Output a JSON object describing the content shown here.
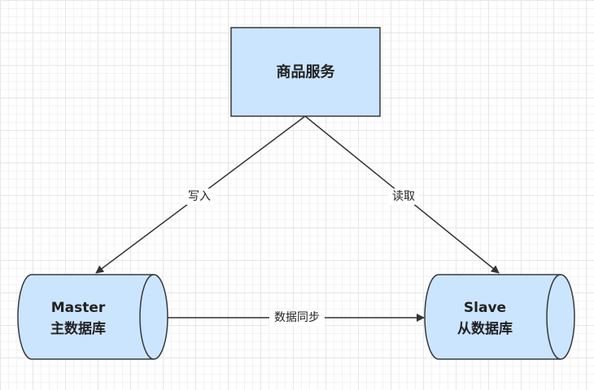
{
  "diagram": {
    "nodes": {
      "service": {
        "label": "商品服务"
      },
      "master": {
        "line1": "Master",
        "line2": "主数据库"
      },
      "slave": {
        "line1": "Slave",
        "line2": "从数据库"
      }
    },
    "edges": {
      "write": {
        "label": "写入"
      },
      "read": {
        "label": "读取"
      },
      "sync": {
        "label": "数据同步"
      }
    }
  },
  "colors": {
    "node_fill": "#cce5ff",
    "node_stroke": "#36393d",
    "edge_stroke": "#333333",
    "text": "#222222"
  }
}
